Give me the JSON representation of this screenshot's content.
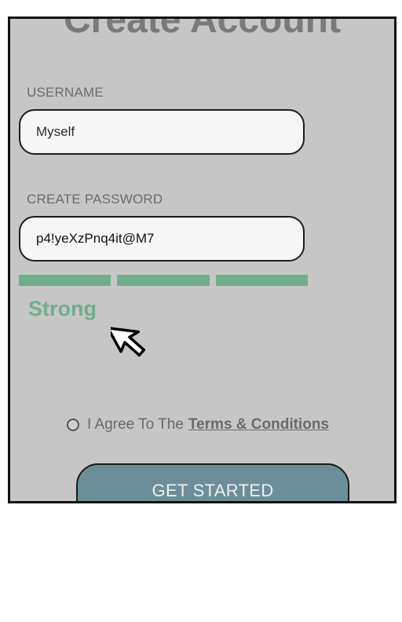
{
  "page": {
    "title": "Create Account"
  },
  "form": {
    "username": {
      "label": "USERNAME",
      "value": "Myself"
    },
    "password": {
      "label": "CREATE PASSWORD",
      "value": "p4!yeXzPnq4it@M7"
    },
    "strength": {
      "label": "Strong",
      "filled_segments": 3,
      "total_segments": 3,
      "color": "#6fae8b"
    },
    "agreement": {
      "text": "I Agree To The",
      "link": "Terms & Conditions",
      "checked": false
    },
    "submit_label": "GET STARTED"
  },
  "colors": {
    "overlay": "#c6c6c6",
    "button": "#6b8e98",
    "strength": "#6fae8b"
  },
  "icons": {
    "cursor": "mouse-pointer-icon"
  }
}
